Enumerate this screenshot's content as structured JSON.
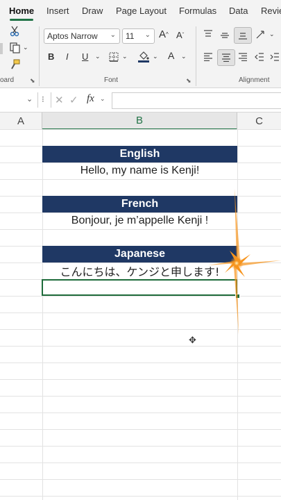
{
  "ribbon_tabs": [
    "Home",
    "Insert",
    "Draw",
    "Page Layout",
    "Formulas",
    "Data",
    "Revie"
  ],
  "font": {
    "name": "Aptos Narrow",
    "size": "11",
    "bold": "B",
    "italic": "I",
    "underline": "U",
    "grow": "A",
    "shrink": "A",
    "font_color": "A",
    "group_label": "Font"
  },
  "clipboard": {
    "group_label": "oard"
  },
  "alignment": {
    "group_label": "Alignment"
  },
  "formula_bar": {
    "fx": "fx",
    "value": ""
  },
  "columns": [
    "A",
    "B",
    "C"
  ],
  "cells": [
    {
      "text": "English",
      "header": true
    },
    {
      "text": "Hello, my name is Kenji!",
      "header": false
    },
    {
      "text": "French",
      "header": true
    },
    {
      "text": "Bonjour, je m’appelle Kenji !",
      "header": false
    },
    {
      "text": "Japanese",
      "header": true
    },
    {
      "text": "こんにちは、ケンジと申します!",
      "header": false
    }
  ],
  "colors": {
    "accent": "#217346",
    "header_fill": "#1f3864",
    "header_text": "#ffffff",
    "sparkle": "#f7941d"
  }
}
